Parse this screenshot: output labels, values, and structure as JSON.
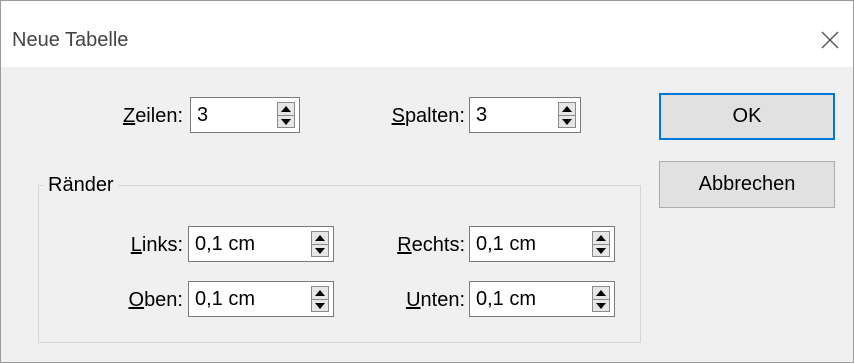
{
  "dialog": {
    "title": "Neue Tabelle"
  },
  "table": {
    "rows_label": "Zeilen:",
    "rows_value": "3",
    "cols_label": "Spalten:",
    "cols_value": "3"
  },
  "margins": {
    "group_title": "Ränder",
    "left_label": "Links:",
    "left_value": "0,1 cm",
    "right_label": "Rechts:",
    "right_value": "0,1 cm",
    "top_label": "Oben:",
    "top_value": "0,1 cm",
    "bottom_label": "Unten:",
    "bottom_value": "0,1 cm"
  },
  "buttons": {
    "ok": "OK",
    "cancel": "Abbrechen"
  },
  "icons": {
    "close": "close-icon",
    "spin_up": "arrow-up-icon",
    "spin_down": "arrow-down-icon"
  },
  "colors": {
    "default_button_border": "#0078d7"
  }
}
